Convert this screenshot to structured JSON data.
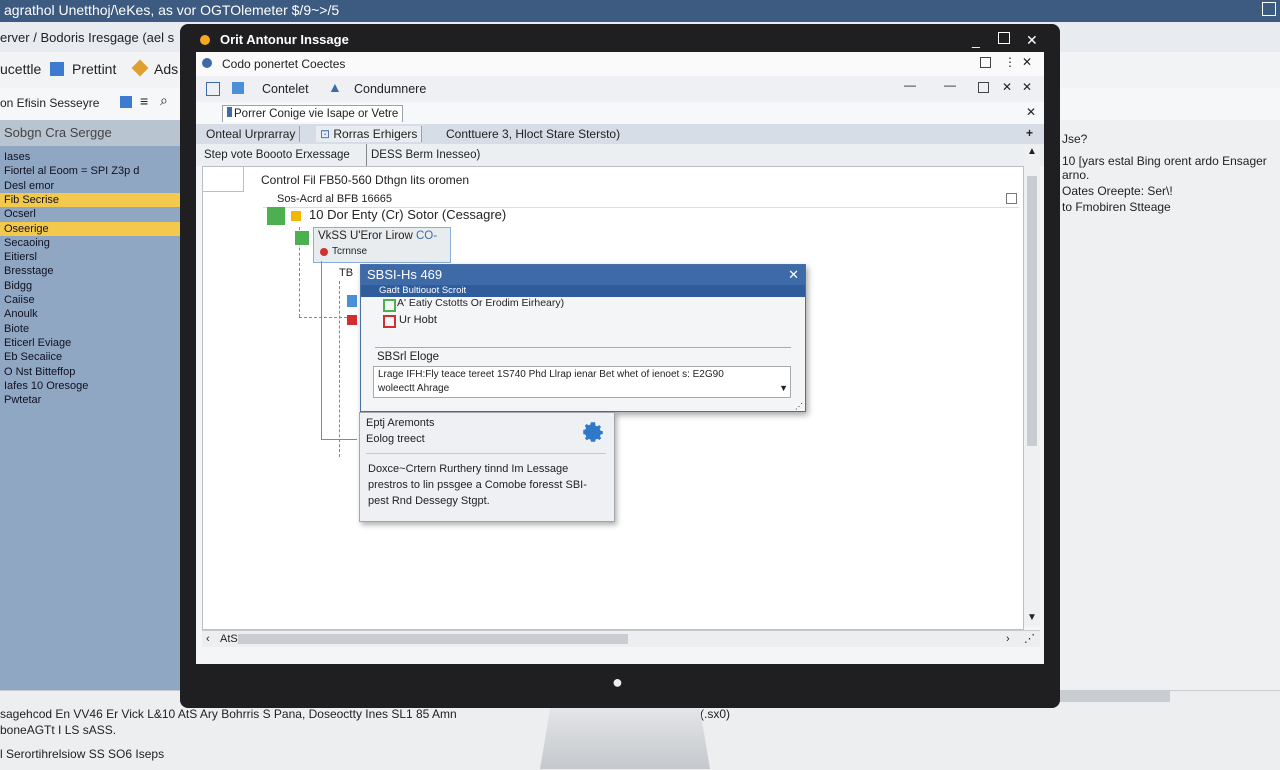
{
  "background_app": {
    "title": "agrathol Unetthoj/\\eKes, as vor OGTOlemeter $/9~>/5",
    "menu": [
      "erver / Bodoris Iresgage (ael s"
    ],
    "toolbar": [
      "ucettle",
      "Prettint",
      "Ads"
    ],
    "toolbar2": "on Efisin Sesseyre",
    "left_header": "Sobgn Cra Sergge",
    "left_rows": [
      {
        "label": "Iases",
        "selected": false
      },
      {
        "label": "Fiortel al Eoom = SPI  Z3p d",
        "selected": false
      },
      {
        "label": "Desl emor",
        "selected": false
      },
      {
        "label": "Fib Secrise",
        "selected": true
      },
      {
        "label": "Ocserl",
        "selected": false
      },
      {
        "label": "Oseerige",
        "selected": true
      },
      {
        "label": "Secaoing",
        "selected": false
      },
      {
        "label": "Eitiersl",
        "selected": false
      },
      {
        "label": "Bresstage",
        "selected": false
      },
      {
        "label": "Bidgg",
        "selected": false
      },
      {
        "label": "Caiise",
        "selected": false
      },
      {
        "label": "Anoulk",
        "selected": false
      },
      {
        "label": "Biote",
        "selected": false
      },
      {
        "label": "Eticerl Eviage",
        "selected": false
      },
      {
        "label": "Eb Secaiice",
        "selected": false
      },
      {
        "label": "O Nst Bitteffop",
        "selected": false
      },
      {
        "label": "Iafes 10 Oresoge",
        "selected": false
      },
      {
        "label": "Pwtetar",
        "selected": false
      }
    ],
    "right_panel": [
      "Jse?",
      "10 [yars estal Bing orent ardo Ensager",
      "arno.",
      "Oates Oreepte: Ser\\!",
      "to Fmobiren Stteage"
    ],
    "status_lines": [
      "sagehcod En VV46 Er Vick  L&10 AtS Ary Bohrris S Pana, Doseoctty Ines SL1 85 Amn",
      "(.sx0)",
      "boneAGTt I LS sASS.",
      "l Serortihrelsiow SS SO6 Iseps"
    ]
  },
  "window": {
    "title": "Orit Antonur Inssage",
    "row1_title": "Codo ponertet Coectes",
    "row2_labels": [
      "Contelet",
      "Condumnere"
    ],
    "row3_tab": "Porrer Conige vie Isape or Vetre",
    "tabs": [
      "Onteal Urprarray",
      "Rorras Erhigers",
      "Conttuere 3,  Hloct Stare Stersto)"
    ],
    "breadcrumb": [
      "Step vote Boooto Erxessage",
      "DESS Berm Inesseo)"
    ],
    "hscroll_label": "AtS5"
  },
  "tree": {
    "root": "Control Fil FB50-560 Dthgn lits oromen",
    "field": "Sos-Acrd al BFB 16665",
    "node1": "10 Dor Enty (Cr) Sotor (Cessagre)",
    "node2_a": "VkSS U'Eror Lirow",
    "node2_b": "CO-",
    "node2_sub": "Tcrnnse",
    "node3": "TB",
    "node4": "B"
  },
  "dialog": {
    "title": "SBSI-Hs 469",
    "selected_row": "Gadt  Bultiouot Scroit",
    "items": [
      "A' Eatiy Cstotts Or Erodim Eirheary)",
      "Ur Hobt"
    ],
    "field_label": "SBSrl Eloge",
    "field_text": "Lrage IFH:Fly teace tereet 1S740 Phd Llrap ienar Bet whet of ienoet s: E2G90",
    "field_text2": "woleectt Ahrage"
  },
  "info_card": {
    "line1": "Eptj Aremonts",
    "line2": "Eolog treect",
    "body": "Doxce~Crtern Rurthery tinnd Im Lessage prestros to lin pssgee a Comobe foresst SBI-pest Rnd Dessegy Stgpt."
  },
  "colors": {
    "accent": "#3f6aa8",
    "highlight": "#f2c94c",
    "panel": "#8fa7c2",
    "frame": "#1f1f21"
  }
}
